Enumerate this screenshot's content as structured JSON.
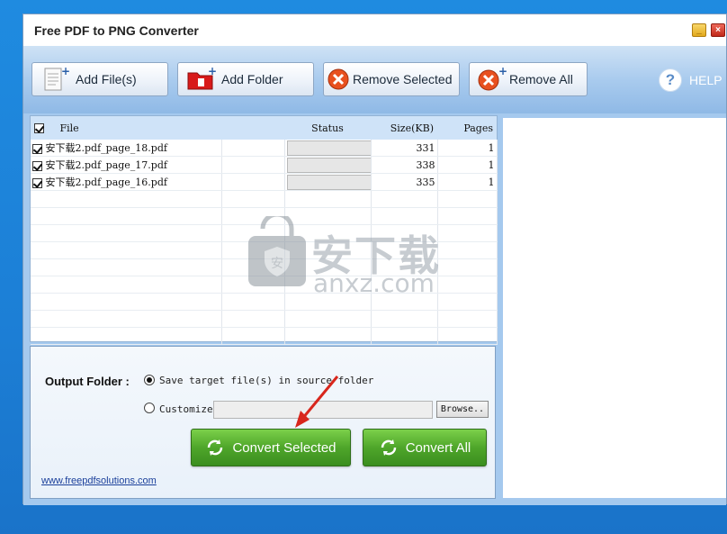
{
  "window": {
    "title": "Free PDF to PNG Converter"
  },
  "toolbar": {
    "add_files": "Add File(s)",
    "add_folder": "Add Folder",
    "remove_selected": "Remove Selected",
    "remove_all": "Remove All",
    "help": "HELP"
  },
  "table": {
    "headers": {
      "file": "File",
      "status": "Status",
      "size": "Size(KB)",
      "pages": "Pages"
    },
    "rows": [
      {
        "file": "安下载2.pdf_page_18.pdf",
        "size": "331",
        "pages": "1",
        "checked": true
      },
      {
        "file": "安下载2.pdf_page_17.pdf",
        "size": "338",
        "pages": "1",
        "checked": true
      },
      {
        "file": "安下载2.pdf_page_16.pdf",
        "size": "335",
        "pages": "1",
        "checked": true
      }
    ]
  },
  "output": {
    "label": "Output Folder :",
    "option_source": "Save target file(s) in source folder",
    "option_custom": "Customize",
    "custom_value": "",
    "browse": "Browse..",
    "convert_selected": "Convert Selected",
    "convert_all": "Convert All",
    "link": "www.freepdfsolutions.com"
  },
  "watermark": {
    "text": "安下载",
    "sub": "anxz.com"
  },
  "colors": {
    "accent_blue": "#a5c9ee",
    "green_button": "#4fa62a",
    "desktop": "#1c7fd6"
  }
}
